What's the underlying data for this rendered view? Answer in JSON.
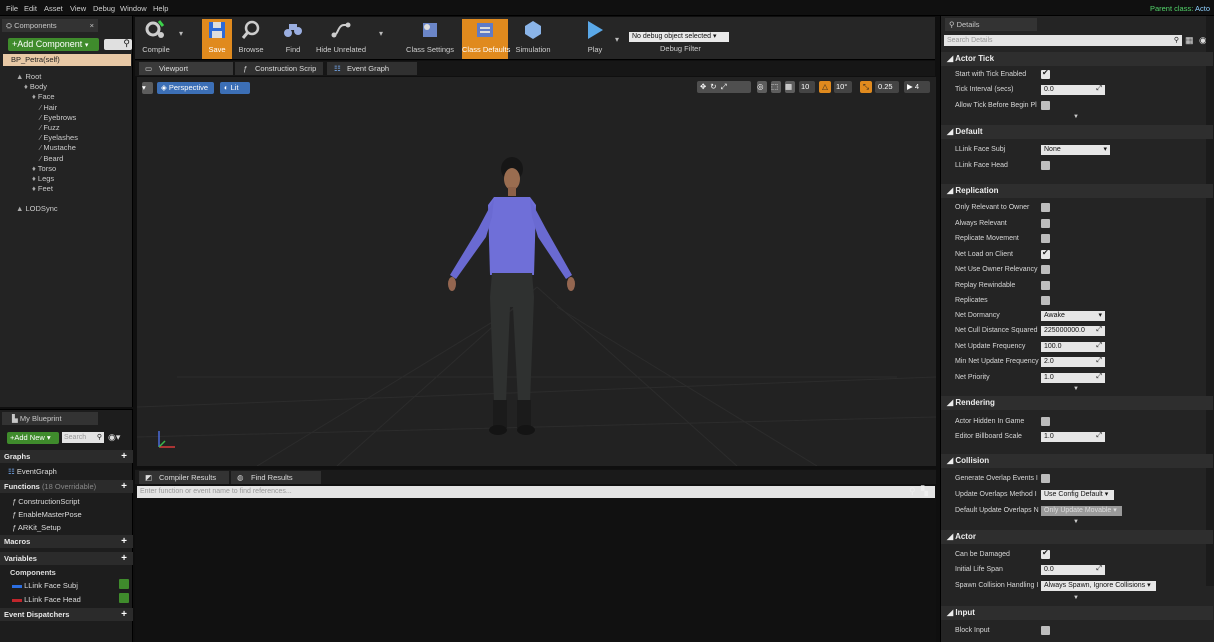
{
  "menu": [
    "File",
    "Edit",
    "Asset",
    "View",
    "Debug",
    "Window",
    "Help"
  ],
  "parent_class": {
    "label": "Parent class:",
    "value": "Acto"
  },
  "components_panel": {
    "tab": "Components",
    "add_button": "+Add Component",
    "blueprint_self": "BP_Petra(self)",
    "tree": [
      {
        "label": "Root",
        "indent": 0
      },
      {
        "label": "Body",
        "indent": 1
      },
      {
        "label": "Face",
        "indent": 2
      },
      {
        "label": "Hair",
        "indent": 3
      },
      {
        "label": "Eyebrows",
        "indent": 3
      },
      {
        "label": "Fuzz",
        "indent": 3
      },
      {
        "label": "Eyelashes",
        "indent": 3
      },
      {
        "label": "Mustache",
        "indent": 3
      },
      {
        "label": "Beard",
        "indent": 3
      },
      {
        "label": "Torso",
        "indent": 2
      },
      {
        "label": "Legs",
        "indent": 2
      },
      {
        "label": "Feet",
        "indent": 2
      },
      {
        "label": "LODSync",
        "indent": 0
      }
    ]
  },
  "my_blueprint": {
    "tab": "My Blueprint",
    "add_button": "+Add New",
    "search_placeholder": "Search",
    "graphs_header": "Graphs",
    "graphs": [
      "EventGraph"
    ],
    "functions_header": "Functions",
    "functions_count": "(18 Overridable)",
    "functions": [
      "ConstructionScript",
      "EnableMasterPose",
      "ARKit_Setup"
    ],
    "macros_header": "Macros",
    "variables_header": "Variables",
    "components_sub": "Components",
    "variables": [
      "LLink Face Subj",
      "LLink Face Head"
    ],
    "dispatchers_header": "Event Dispatchers"
  },
  "toolbar": {
    "compile": "Compile",
    "save": "Save",
    "browse": "Browse",
    "find": "Find",
    "hide_unrelated": "Hide Unrelated",
    "class_settings": "Class Settings",
    "class_defaults": "Class Defaults",
    "simulation": "Simulation",
    "play": "Play",
    "debug_select": "No debug object selected",
    "debug_filter": "Debug Filter"
  },
  "editor_tabs": [
    "Viewport",
    "Construction Scrip",
    "Event Graph"
  ],
  "viewport": {
    "perspective": "Perspective",
    "lit": "Lit",
    "grid_snap": "10",
    "angle_snap": "10°",
    "scale_snap": "0.25",
    "camera_speed": "4"
  },
  "results": {
    "tabs": [
      "Compiler Results",
      "Find Results"
    ],
    "search_placeholder": "Enter function or event name to find references..."
  },
  "details": {
    "tab": "Details",
    "search_placeholder": "Search Details",
    "sections": {
      "actor_tick": "Actor Tick",
      "default": "Default",
      "replication": "Replication",
      "rendering": "Rendering",
      "collision": "Collision",
      "actor": "Actor",
      "input": "Input"
    },
    "labels": {
      "start_tick": "Start with Tick Enabled",
      "tick_interval": "Tick Interval (secs)",
      "allow_tick": "Allow Tick Before Begin Pl",
      "face_subj": "LLink Face Subj",
      "face_head": "LLink Face Head",
      "only_relevant": "Only Relevant to Owner",
      "always_relevant": "Always Relevant",
      "replicate_movement": "Replicate Movement",
      "net_load": "Net Load on Client",
      "net_use_owner": "Net Use Owner Relevancy",
      "replay_rewind": "Replay Rewindable",
      "replicates": "Replicates",
      "net_dormancy": "Net Dormancy",
      "net_cull": "Net Cull Distance Squared",
      "net_update": "Net Update Frequency",
      "min_net_update": "Min Net Update Frequency",
      "net_priority": "Net Priority",
      "hidden": "Actor Hidden In Game",
      "billboard": "Editor Billboard Scale",
      "gen_overlap": "Generate Overlap Events I",
      "update_overlap": "Update Overlaps Method I",
      "default_update": "Default Update Overlaps N",
      "can_damage": "Can be Damaged",
      "life_span": "Initial Life Span",
      "spawn_collision": "Spawn Collision Handling I",
      "block_input": "Block Input"
    },
    "values": {
      "tick_interval": "0.0",
      "face_subj": "None",
      "net_dormancy": "Awake",
      "net_cull": "225000000.0",
      "net_update": "100.0",
      "min_net_update": "2.0",
      "net_priority": "1.0",
      "billboard": "1.0",
      "update_overlap": "Use Config Default",
      "default_update": "Only Update Movable",
      "life_span": "0.0",
      "spawn_collision": "Always Spawn, Ignore Collisions"
    }
  },
  "colors": {
    "accent_green": "#3f8b2c",
    "highlight_orange": "#e08a1e",
    "play_blue": "#5aa8e8"
  }
}
